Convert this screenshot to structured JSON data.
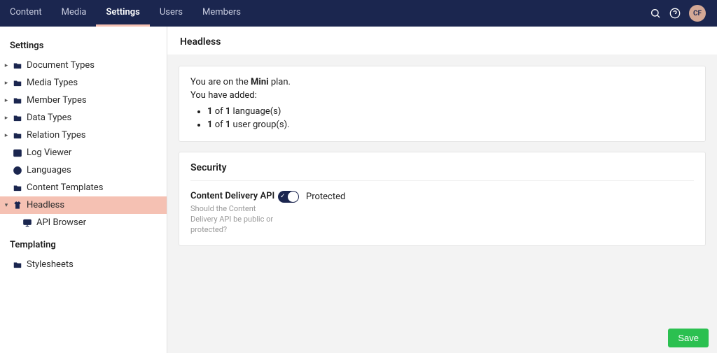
{
  "topnav": {
    "tabs": [
      "Content",
      "Media",
      "Settings",
      "Users",
      "Members"
    ],
    "active_index": 2,
    "avatar": "CF"
  },
  "sidebar": {
    "section1_title": "Settings",
    "items1": [
      {
        "label": "Document Types",
        "icon": "folder",
        "expandable": true
      },
      {
        "label": "Media Types",
        "icon": "folder",
        "expandable": true
      },
      {
        "label": "Member Types",
        "icon": "folder",
        "expandable": true
      },
      {
        "label": "Data Types",
        "icon": "folder",
        "expandable": true
      },
      {
        "label": "Relation Types",
        "icon": "folder",
        "expandable": true
      },
      {
        "label": "Log Viewer",
        "icon": "terminal",
        "expandable": false
      },
      {
        "label": "Languages",
        "icon": "globe",
        "expandable": false
      },
      {
        "label": "Content Templates",
        "icon": "folder",
        "expandable": false
      },
      {
        "label": "Headless",
        "icon": "shirt",
        "expandable": true,
        "expanded": true,
        "active": true
      },
      {
        "label": "API Browser",
        "icon": "monitor",
        "expandable": false,
        "child": true
      }
    ],
    "section2_title": "Templating",
    "items2": [
      {
        "label": "Stylesheets",
        "icon": "folder",
        "expandable": false
      }
    ]
  },
  "page": {
    "title": "Headless",
    "plan": {
      "prefix": "You are on the ",
      "name": "Mini",
      "suffix": " plan.",
      "added": "You have added:",
      "lang_a": "1",
      "lang_of": " of ",
      "lang_b": "1",
      "lang_label": " language(s)",
      "grp_a": "1",
      "grp_of": " of ",
      "grp_b": "1",
      "grp_label": " user group(s)."
    },
    "security": {
      "heading": "Security",
      "api_label": "Content Delivery API",
      "api_help": "Should the Content Delivery API be public or protected?",
      "toggle_value": "Protected",
      "toggle_on": true
    },
    "save": "Save"
  }
}
